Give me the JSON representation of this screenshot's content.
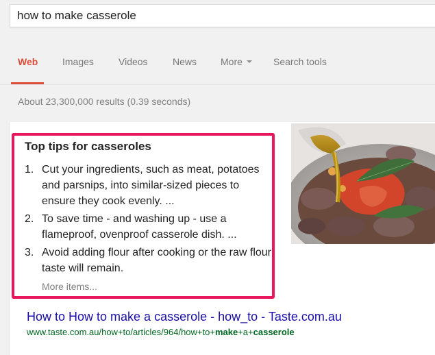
{
  "search": {
    "query": "how to make casserole"
  },
  "tabs": [
    {
      "label": "Web",
      "active": true
    },
    {
      "label": "Images",
      "active": false
    },
    {
      "label": "Videos",
      "active": false
    },
    {
      "label": "News",
      "active": false
    },
    {
      "label": "More",
      "active": false
    },
    {
      "label": "Search tools",
      "active": false
    }
  ],
  "stats": "About 23,300,000 results (0.39 seconds)",
  "featured": {
    "title": "Top tips for casseroles",
    "items": [
      {
        "num": "1.",
        "text": "Cut your ingredients, such as meat, potatoes and parsnips, into similar-sized pieces to ensure they cook evenly. ..."
      },
      {
        "num": "2.",
        "text": "To save time - and washing up - use a flameproof, ovenproof casserole dish. ..."
      },
      {
        "num": "3.",
        "text": "Avoid adding flour after cooking or the raw flour taste will remain."
      }
    ],
    "more_label": "More items...",
    "highlight_color": "#e8175d"
  },
  "result": {
    "title": "How to How to make a casserole - how_to - Taste.com.au",
    "url_prefix": "www.taste.com.au/how+to/articles/964/how+to+",
    "url_bold_1": "make",
    "url_mid": "+a+",
    "url_bold_2": "casserole"
  },
  "colors": {
    "accent": "#dd4b39",
    "link": "#1a0dab",
    "url": "#006621"
  }
}
